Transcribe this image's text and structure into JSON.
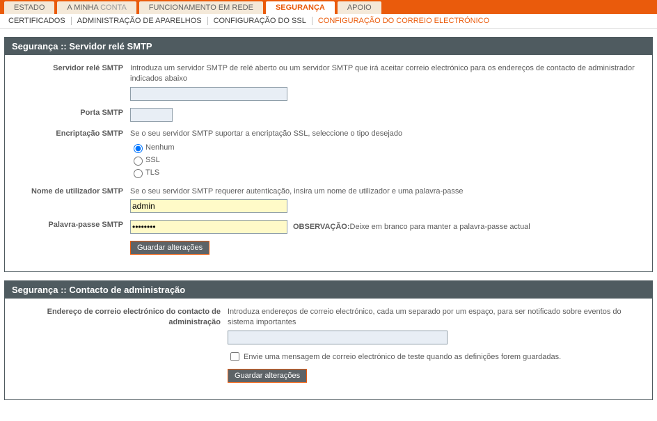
{
  "tabs": {
    "estado": "ESTADO",
    "conta_a": "A MINHA ",
    "conta_b": "CONTA",
    "rede": "FUNCIONAMENTO EM REDE",
    "seguranca": "SEGURANÇA",
    "apoio": "APOIO"
  },
  "subtabs": {
    "cert": "CERTIFICADOS",
    "admin": "ADMINISTRAÇÃO DE APARELHOS",
    "ssl": "CONFIGURAÇÃO DO SSL",
    "mail": "CONFIGURAÇÃO DO CORREIO ELECTRÓNICO"
  },
  "panel1": {
    "title": "Segurança :: Servidor relé SMTP",
    "relay_label": "Servidor relé SMTP",
    "relay_desc": "Introduza um servidor SMTP de relé aberto ou um servidor SMTP que irá aceitar correio electrónico para os endereços de contacto de administrador indicados abaixo",
    "relay_value": "",
    "port_label": "Porta SMTP",
    "port_value": "",
    "enc_label": "Encriptação SMTP",
    "enc_desc": "Se o seu servidor SMTP suportar a encriptação SSL, seleccione o tipo desejado",
    "enc_none": "Nenhum",
    "enc_ssl": "SSL",
    "enc_tls": "TLS",
    "user_label": "Nome de utilizador SMTP",
    "user_desc": "Se o seu servidor SMTP requerer autenticação, insira um nome de utilizador e uma palavra-passe",
    "user_value": "admin",
    "pass_label": "Palavra-passe SMTP",
    "pass_value": "••••••••",
    "pass_note_bold": "OBSERVAÇÃO:",
    "pass_note": " Deixe em branco para manter a palavra-passe actual",
    "save_btn": "Guardar alterações"
  },
  "panel2": {
    "title": "Segurança :: Contacto de administração",
    "email_label": "Endereço de correio electrónico do contacto de administração",
    "email_desc": "Introduza endereços de correio electrónico, cada um separado por um espaço, para ser notificado sobre eventos do sistema importantes",
    "email_value": "",
    "test_label": " Envie uma mensagem de correio electrónico de teste quando as definições forem guardadas.",
    "save_btn": "Guardar alterações"
  }
}
